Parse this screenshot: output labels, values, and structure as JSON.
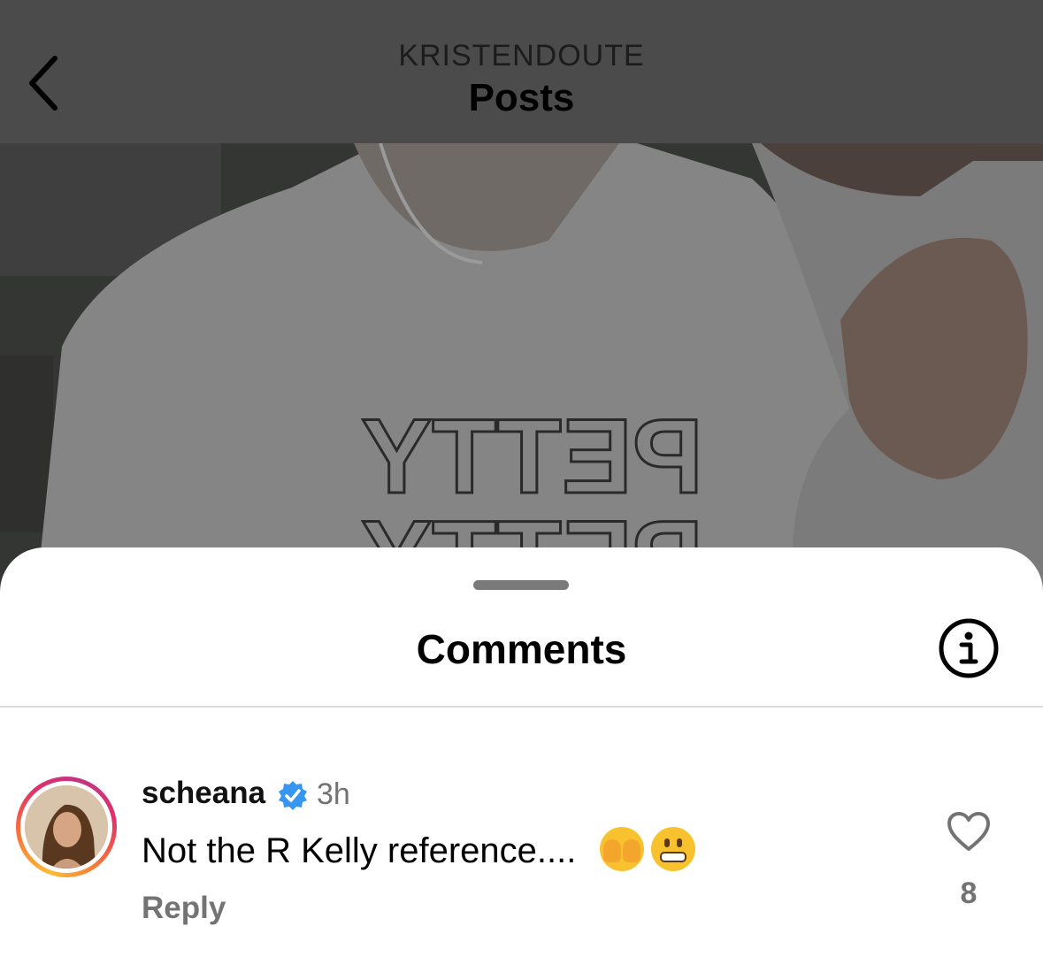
{
  "header": {
    "username": "KRISTENDOUTE",
    "title": "Posts",
    "back_icon": "chevron-left-icon"
  },
  "post_image": {
    "shirt_text": "PETTY PETTY"
  },
  "comments_sheet": {
    "title": "Comments",
    "info_icon": "info-icon"
  },
  "comments": [
    {
      "username": "scheana",
      "verified": true,
      "time": "3h",
      "text": "Not the R Kelly reference.... ",
      "emojis": [
        "face-with-open-eyes-and-hand-over-mouth",
        "grimacing-face"
      ],
      "reply_label": "Reply",
      "like_count": "8"
    }
  ],
  "colors": {
    "overlay": "#4a4a4a",
    "muted_text": "#737373",
    "verified_blue": "#3797f0"
  }
}
